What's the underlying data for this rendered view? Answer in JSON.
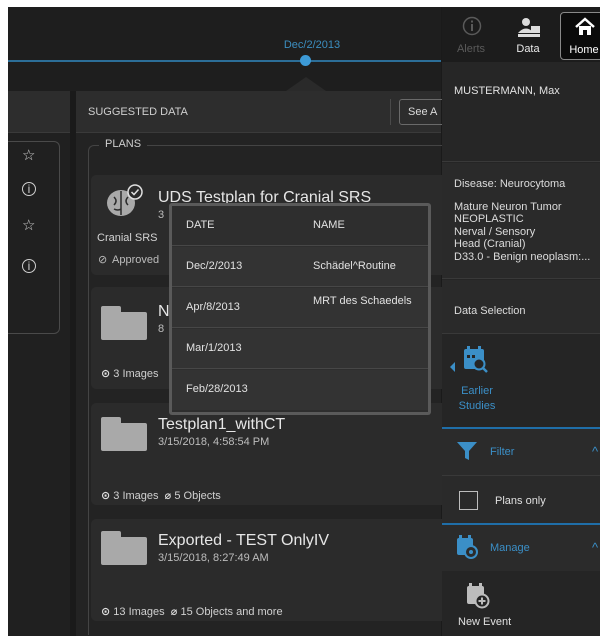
{
  "timeline": {
    "selected_date": "Dec/2/2013"
  },
  "suggested": {
    "title": "SUGGESTED DATA",
    "see_all_label": "See A",
    "plans_legend": "PLANS",
    "cards": [
      {
        "name": "UDS Testplan for Cranial SRS",
        "timestamp": "3",
        "category": "Cranial SRS",
        "status": "Approved"
      },
      {
        "name": "N",
        "timestamp": "8",
        "stats": {
          "images": "3 Images"
        }
      },
      {
        "name": "Testplan1_withCT",
        "timestamp": "3/15/2018, 4:58:54 PM",
        "stats": {
          "images": "3 Images",
          "objects": "5 Objects"
        }
      },
      {
        "name": "Exported - TEST OnlyIV",
        "timestamp": "3/15/2018, 8:27:49 AM",
        "stats": {
          "images": "13 Images",
          "objects": "15 Objects and more"
        }
      }
    ]
  },
  "popup": {
    "headers": {
      "date": "DATE",
      "name": "NAME"
    },
    "rows": [
      {
        "date": "Dec/2/2013",
        "name": "Schädel^Routine"
      },
      {
        "date": "Apr/8/2013",
        "name": "MRT des Schaedels"
      },
      {
        "date": "Mar/1/2013",
        "name": ""
      },
      {
        "date": "Feb/28/2013",
        "name": ""
      }
    ]
  },
  "right": {
    "tabs": {
      "alerts": "Alerts",
      "data": "Data",
      "home": "Home"
    },
    "patient_name": "MUSTERMANN, Max",
    "disease": {
      "label": "Disease:  Neurocytoma",
      "lines": [
        "Mature Neuron Tumor",
        "NEOPLASTIC",
        "Nerval / Sensory",
        "Head (Cranial)",
        "D33.0 - Benign neoplasm:..."
      ]
    },
    "data_selection": "Data Selection",
    "earlier_studies": "Earlier Studies",
    "filter_label": "Filter",
    "plans_only_label": "Plans only",
    "manage_label": "Manage",
    "new_event_label": "New Event"
  },
  "colors": {
    "accent": "#3b8fc7",
    "background": "#1a1a1a",
    "panel": "#2b2b2b"
  }
}
